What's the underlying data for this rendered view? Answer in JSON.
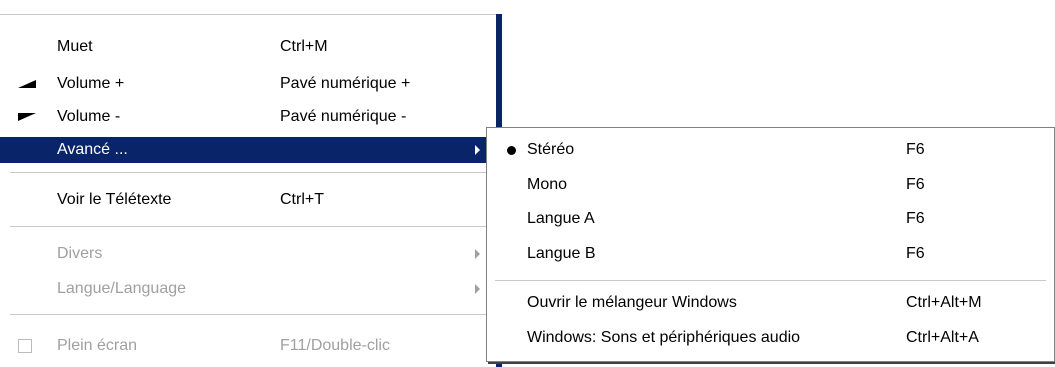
{
  "main_menu": {
    "items": [
      {
        "label": "Muet",
        "shortcut": "Ctrl+M"
      },
      {
        "label": "Volume +",
        "shortcut": "Pavé numérique +",
        "icon": "volume-up-icon"
      },
      {
        "label": "Volume -",
        "shortcut": "Pavé numérique -",
        "icon": "volume-down-icon"
      },
      {
        "label": "Avancé ...",
        "shortcut": "",
        "selected": true,
        "submenu": true
      },
      {
        "label": "Voir le Télétexte",
        "shortcut": "Ctrl+T"
      },
      {
        "label": "Divers",
        "shortcut": "",
        "disabled": true,
        "submenu": true
      },
      {
        "label": "Langue/Language",
        "shortcut": "",
        "disabled": true,
        "submenu": true
      },
      {
        "label": "Plein écran",
        "shortcut": "F11/Double-clic",
        "disabled": true,
        "icon": "checkbox-icon"
      }
    ]
  },
  "submenu": {
    "items": [
      {
        "label": "Stéréo",
        "shortcut": "F6",
        "checked": true
      },
      {
        "label": "Mono",
        "shortcut": "F6"
      },
      {
        "label": "Langue A",
        "shortcut": "F6"
      },
      {
        "label": "Langue B",
        "shortcut": "F6"
      },
      {
        "label": "Ouvrir le mélangeur Windows",
        "shortcut": "Ctrl+Alt+M"
      },
      {
        "label": "Windows: Sons et périphériques audio",
        "shortcut": "Ctrl+Alt+A"
      }
    ]
  },
  "colors": {
    "selection": "#0a246a",
    "disabled_text": "#a0a0a0"
  }
}
